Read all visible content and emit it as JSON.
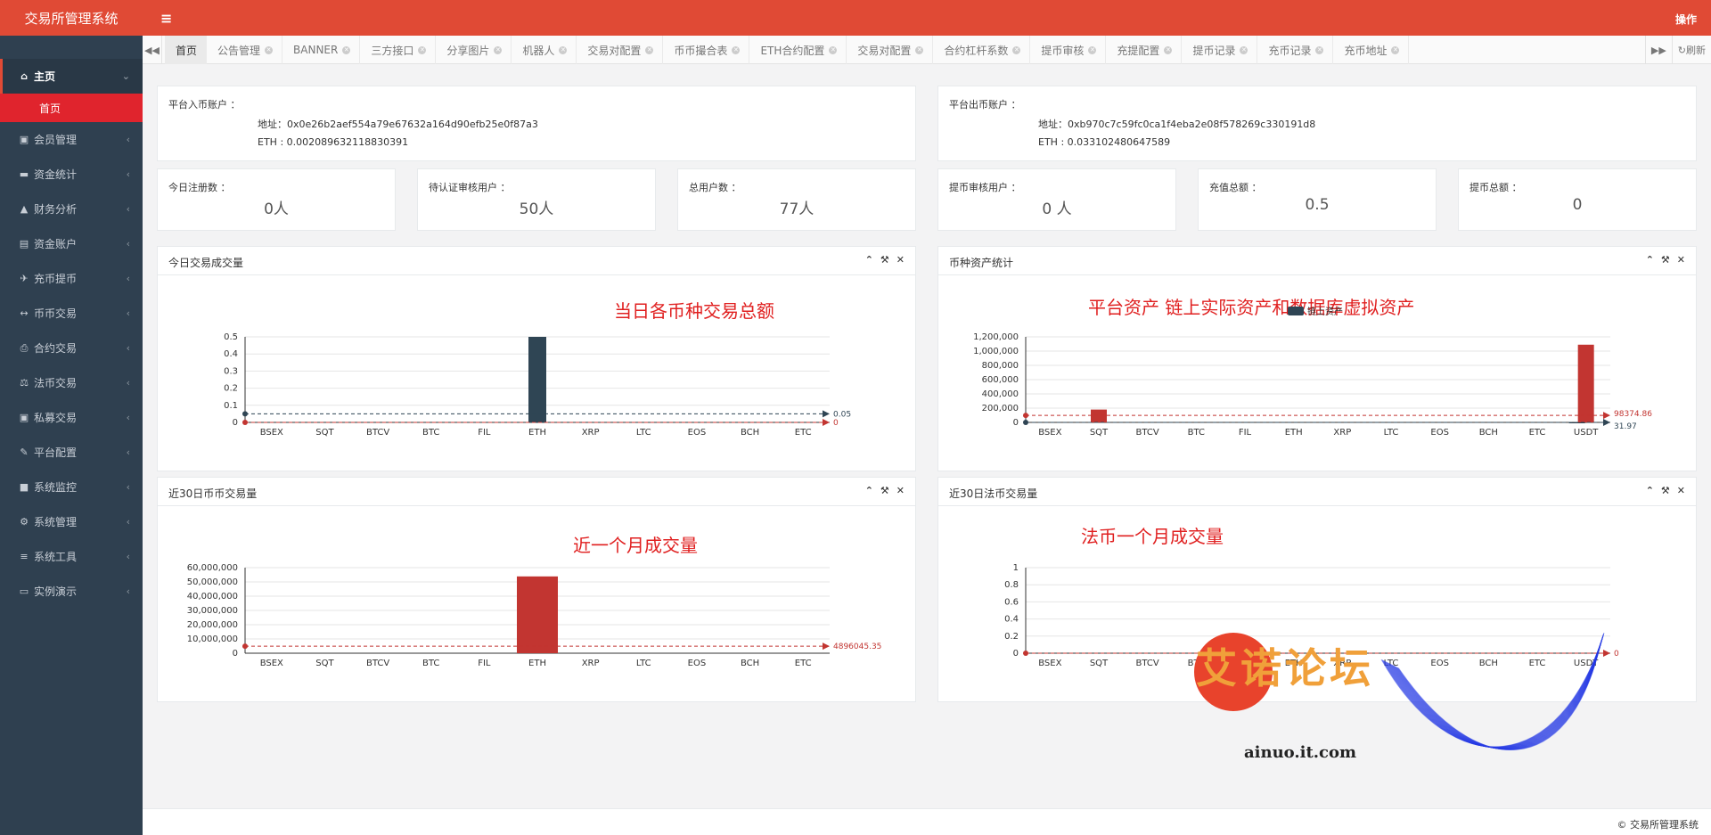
{
  "app": {
    "title": "交易所管理系统",
    "operations": "操作",
    "copyright": "© 交易所管理系统"
  },
  "sidebar": {
    "home": {
      "label": "主页",
      "icon": "home-icon"
    },
    "home_sub": "首页",
    "items": [
      {
        "label": "会员管理",
        "icon": "member-icon"
      },
      {
        "label": "资金统计",
        "icon": "funds-icon"
      },
      {
        "label": "财务分析",
        "icon": "chart-icon"
      },
      {
        "label": "资金账户",
        "icon": "account-icon"
      },
      {
        "label": "充币提币",
        "icon": "plane-icon"
      },
      {
        "label": "币币交易",
        "icon": "exchange-icon"
      },
      {
        "label": "合约交易",
        "icon": "contract-icon"
      },
      {
        "label": "法币交易",
        "icon": "fiat-icon"
      },
      {
        "label": "私募交易",
        "icon": "private-icon"
      },
      {
        "label": "平台配置",
        "icon": "config-icon"
      },
      {
        "label": "系统监控",
        "icon": "video-icon"
      },
      {
        "label": "系统管理",
        "icon": "gear-icon"
      },
      {
        "label": "系统工具",
        "icon": "list-icon"
      },
      {
        "label": "实例演示",
        "icon": "desktop-icon"
      }
    ]
  },
  "tabs": [
    "首页",
    "公告管理",
    "BANNER",
    "三方接口",
    "分享图片",
    "机器人",
    "交易对配置",
    "币币撮合表",
    "ETH合约配置",
    "交易对配置",
    "合约杠杆系数",
    "提币审核",
    "充提配置",
    "提币记录",
    "充币记录",
    "充币地址"
  ],
  "refresh": "刷新",
  "accounts": {
    "in": {
      "title": "平台入币账户 ：",
      "address": "地址：0x0e26b2aef554a79e67632a164d90efb25e0f87a3",
      "eth": "ETH : 0.002089632118830391"
    },
    "out": {
      "title": "平台出币账户 ：",
      "address": "地址：0xb970c7c59fc0ca1f4eba2e08f578269c330191d8",
      "eth": "ETH : 0.033102480647589"
    }
  },
  "stats": [
    {
      "label": "今日注册数 ：",
      "value": "0人"
    },
    {
      "label": "待认证审核用户 ：",
      "value": "50人"
    },
    {
      "label": "总用户数 ：",
      "value": "77人"
    },
    {
      "label": "提币审核用户 ：",
      "value": "0 人"
    },
    {
      "label": "充值总额 ：",
      "value": "0.5"
    },
    {
      "label": "提币总额 ：",
      "value": "0"
    }
  ],
  "colors": {
    "accent": "#e04a35",
    "sidebar": "#2f4050",
    "bar_dark": "#2f4554",
    "bar_red": "#c23531"
  },
  "chart_data": [
    {
      "id": "today",
      "type": "bar",
      "title": "今日交易成交量",
      "annotation": "当日各币种交易总额",
      "categories": [
        "BSEX",
        "SQT",
        "BTCV",
        "BTC",
        "FIL",
        "ETH",
        "XRP",
        "LTC",
        "EOS",
        "BCH",
        "ETC"
      ],
      "series": [
        {
          "values": [
            0,
            0,
            0,
            0,
            0,
            0.5,
            0,
            0,
            0,
            0,
            0
          ]
        }
      ],
      "ylim": [
        0,
        0.5
      ],
      "yticks": [
        0,
        0.1,
        0.2,
        0.3,
        0.4,
        0.5
      ],
      "markLines": [
        {
          "value": 0.05,
          "label": "0.05"
        },
        {
          "value": 0,
          "label": "0"
        }
      ]
    },
    {
      "id": "assets",
      "type": "bar",
      "title": "币种资产统计",
      "annotation": "平台资产 链上实际资产和数据库虚拟资产",
      "legend": "链上资产",
      "categories": [
        "BSEX",
        "SQT",
        "BTCV",
        "BTC",
        "FIL",
        "ETH",
        "XRP",
        "LTC",
        "EOS",
        "BCH",
        "ETC",
        "USDT"
      ],
      "series": [
        {
          "name": "链上资产",
          "values": [
            0,
            0,
            0,
            0,
            0,
            0,
            0,
            0,
            0,
            0,
            0,
            30
          ]
        },
        {
          "values": [
            0,
            180000,
            0,
            0,
            0,
            0,
            0,
            0,
            0,
            0,
            0,
            1090000
          ]
        }
      ],
      "ylim": [
        0,
        1200000
      ],
      "yticks": [
        0,
        200000,
        400000,
        600000,
        800000,
        1000000,
        1200000
      ],
      "markLines": [
        {
          "value": 98374.86,
          "label": "98374.86"
        },
        {
          "value": 31.97,
          "label": "31.97"
        }
      ]
    },
    {
      "id": "month_coin",
      "type": "bar",
      "title": "近30日币币交易量",
      "annotation": "近一个月成交量",
      "categories": [
        "BSEX",
        "SQT",
        "BTCV",
        "BTC",
        "FIL",
        "ETH",
        "XRP",
        "LTC",
        "EOS",
        "BCH",
        "ETC"
      ],
      "series": [
        {
          "values": [
            0,
            0,
            0,
            0,
            0,
            53860000,
            0,
            0,
            0,
            0,
            0
          ]
        }
      ],
      "ylim": [
        0,
        60000000
      ],
      "yticks": [
        0,
        10000000,
        20000000,
        30000000,
        40000000,
        50000000,
        60000000
      ],
      "markLines": [
        {
          "value": 4896045.35,
          "label": "4896045.35"
        }
      ]
    },
    {
      "id": "month_fiat",
      "type": "bar",
      "title": "近30日法币交易量",
      "annotation": "法币一个月成交量",
      "categories": [
        "BSEX",
        "SQT",
        "BTCV",
        "BTC",
        "FIL",
        "ETH",
        "XRP",
        "LTC",
        "EOS",
        "BCH",
        "ETC",
        "USDT"
      ],
      "series": [
        {
          "values": [
            0,
            0,
            0,
            0,
            0,
            0,
            0,
            0,
            0,
            0,
            0,
            0
          ]
        }
      ],
      "ylim": [
        0,
        1
      ],
      "yticks": [
        0,
        0.2,
        0.4,
        0.6,
        0.8,
        1
      ],
      "markLines": [
        {
          "value": 0,
          "label": "0"
        }
      ]
    }
  ],
  "watermark": {
    "text": "艾诺论坛",
    "url": "ainuo.it.com"
  }
}
